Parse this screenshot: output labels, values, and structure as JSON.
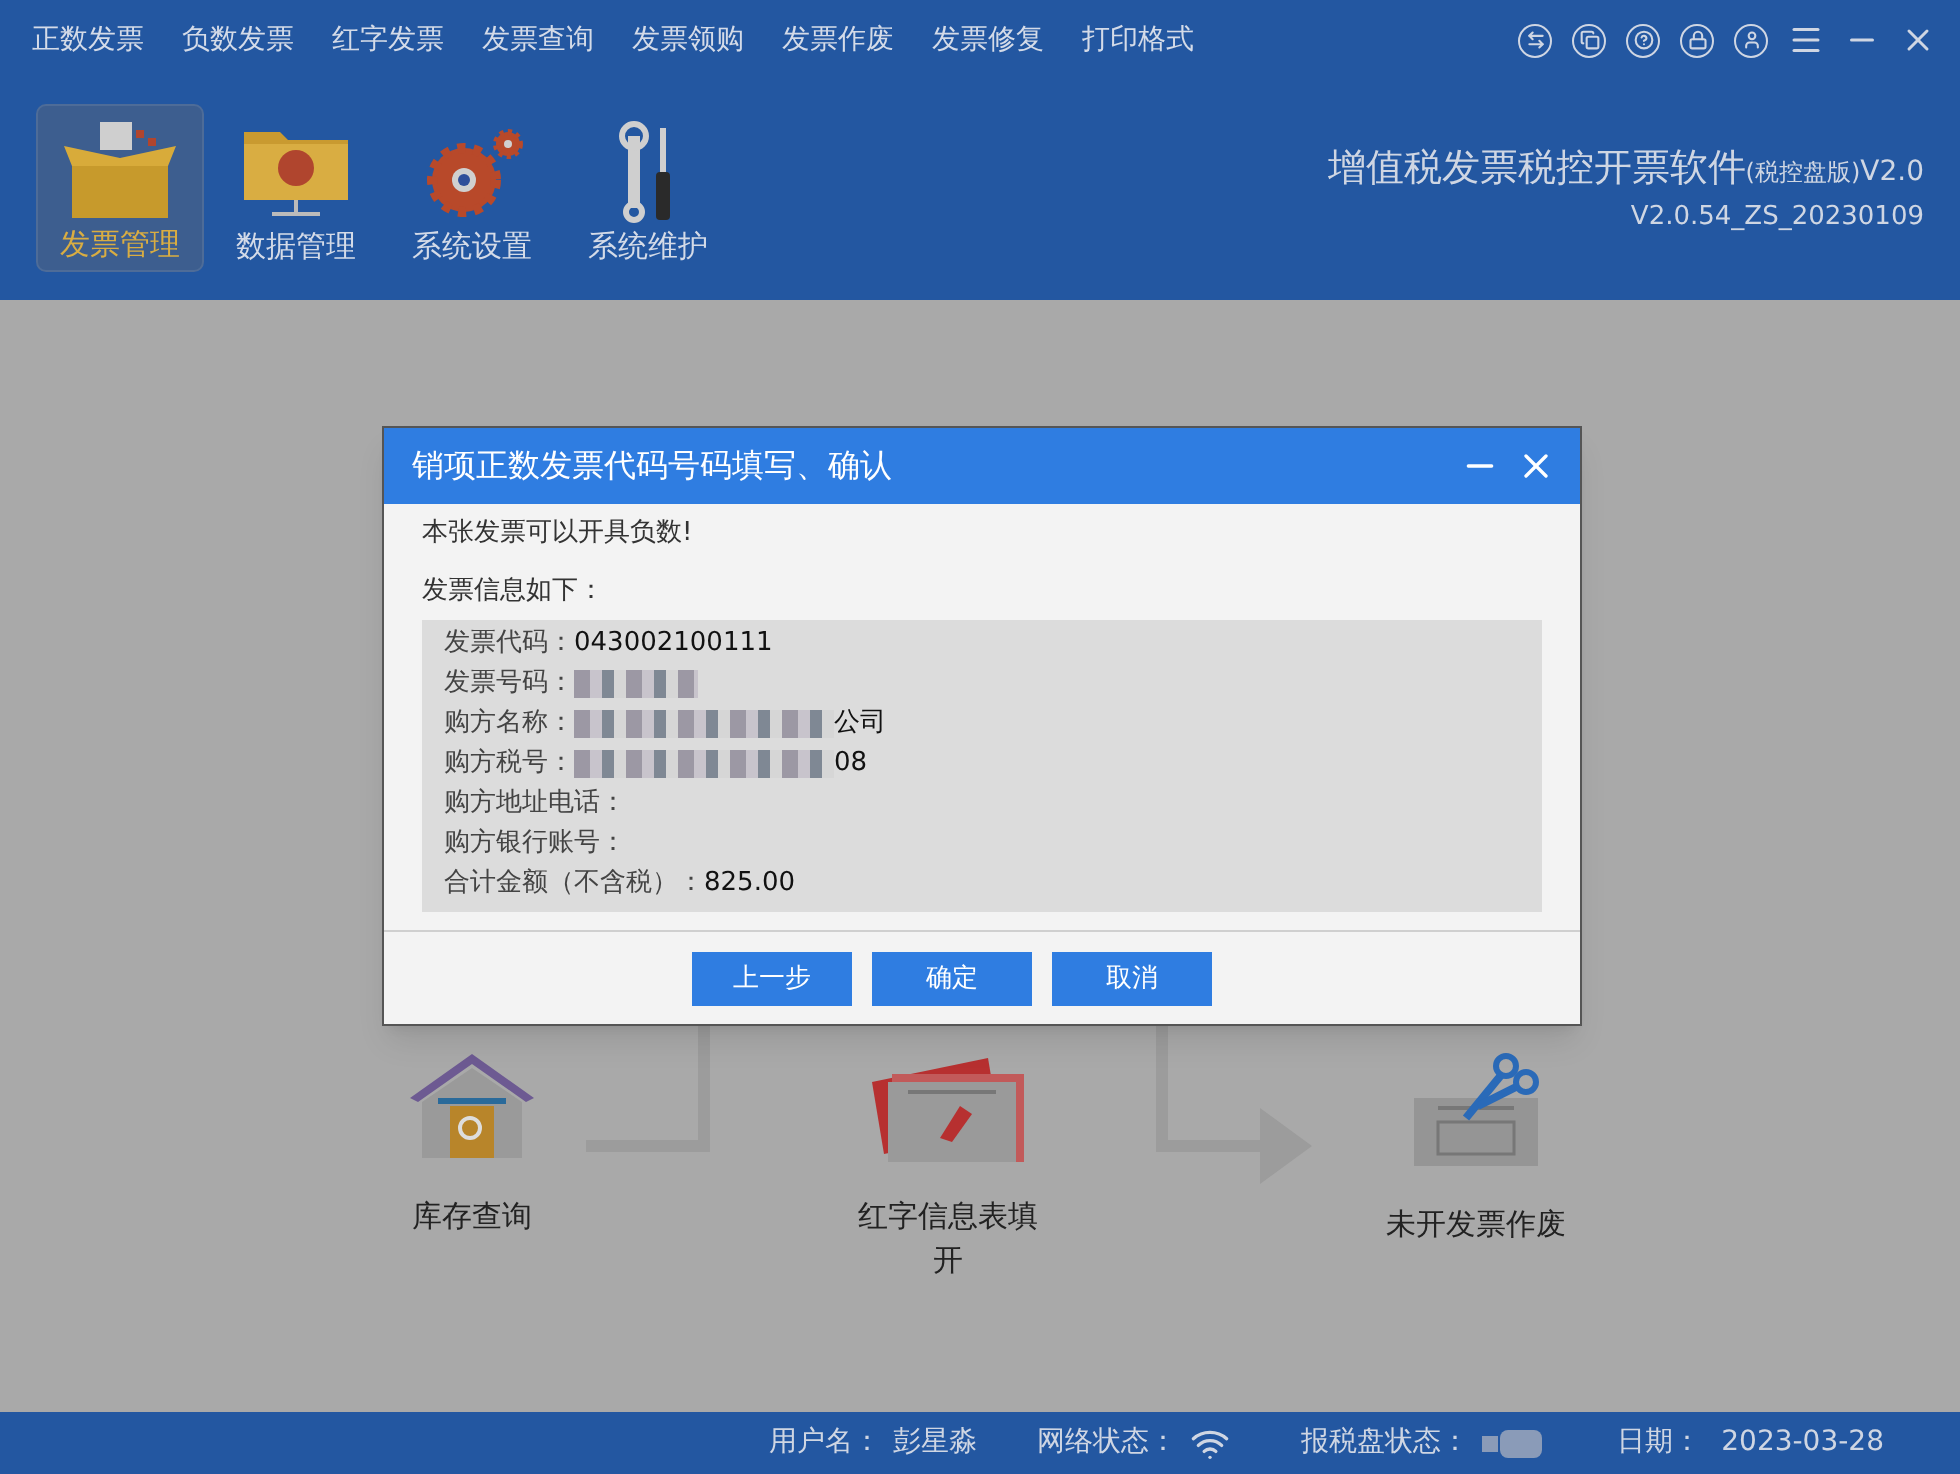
{
  "menu": [
    {
      "label": "正数发票"
    },
    {
      "label": "负数发票"
    },
    {
      "label": "红字发票"
    },
    {
      "label": "发票查询"
    },
    {
      "label": "发票领购"
    },
    {
      "label": "发票作废"
    },
    {
      "label": "发票修复"
    },
    {
      "label": "打印格式"
    }
  ],
  "toolbar": [
    {
      "label": "发票管理",
      "kind": "box",
      "selected": true
    },
    {
      "label": "数据管理",
      "kind": "folder",
      "selected": false
    },
    {
      "label": "系统设置",
      "kind": "gears",
      "selected": false
    },
    {
      "label": "系统维护",
      "kind": "tools",
      "selected": false
    }
  ],
  "app_title": {
    "name": "增值税发票税控开票软件",
    "edition": "(税控盘版)",
    "version_short": "V2.0",
    "version": "V2.0.54_ZS_20230109"
  },
  "flow": [
    {
      "label": "库存查询",
      "kind": "house"
    },
    {
      "label": "红字信息表填开",
      "kind": "tickets"
    },
    {
      "label": "未开发票作废",
      "kind": "scissors"
    }
  ],
  "dialog": {
    "title": "销项正数发票代码号码填写、确认",
    "message": "本张发票可以开具负数!",
    "info_heading": "发票信息如下：",
    "fields": [
      {
        "label": "发票代码：",
        "value": "043002100111",
        "redacted": false
      },
      {
        "label": "发票号码：",
        "redacted": true
      },
      {
        "label": "购方名称：",
        "value": "公司",
        "redacted": true
      },
      {
        "label": "购方税号：",
        "value": "08",
        "redacted": true
      },
      {
        "label": "购方地址电话：",
        "redacted": false
      },
      {
        "label": "购方银行账号：",
        "redacted": false
      },
      {
        "label": "合计金额（不含税）：",
        "value": "825.00",
        "redacted": false
      }
    ],
    "buttons": [
      {
        "label": "上一步"
      },
      {
        "label": "确定"
      },
      {
        "label": "取消"
      }
    ]
  },
  "status_bar": {
    "user_label": "用户名：",
    "user": "彭星淼",
    "network_label": "网络状态：",
    "disk_label": "报税盘状态：",
    "date_label": "日期：",
    "date": "2023-03-28"
  }
}
